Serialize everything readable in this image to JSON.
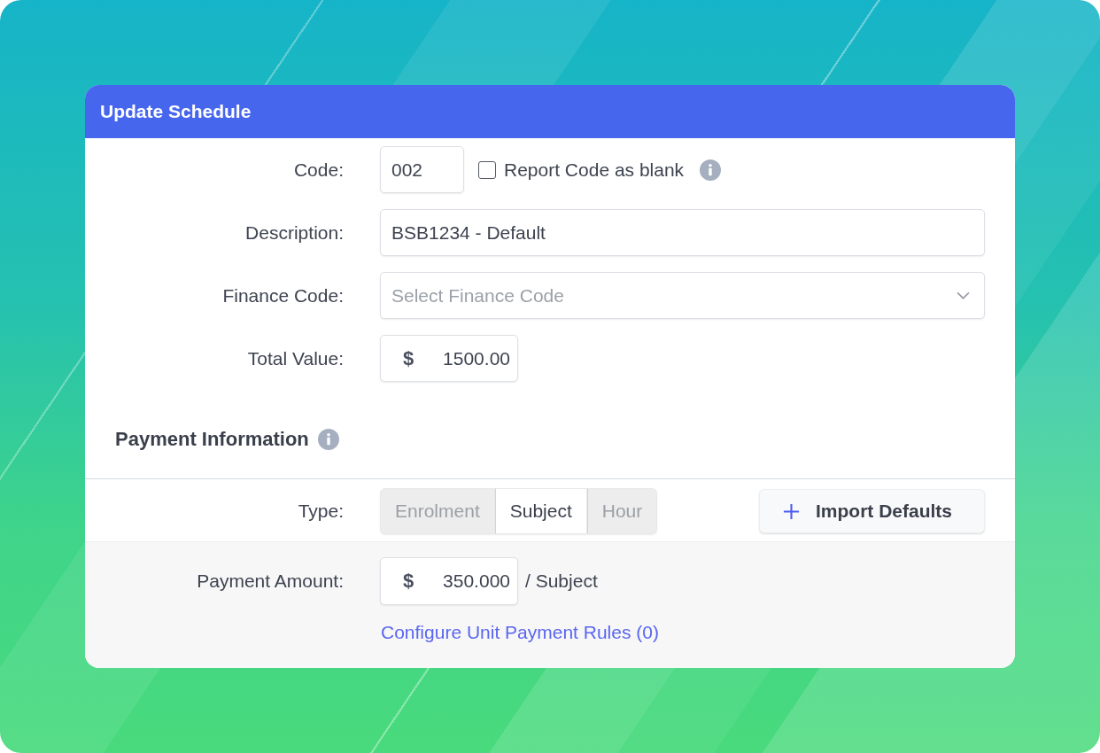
{
  "dialog": {
    "title": "Update Schedule"
  },
  "fields": [
    {
      "kind": "code",
      "label": "Code:",
      "value": "002",
      "checkbox": {
        "label": "Report Code as blank",
        "checked": false
      }
    },
    {
      "kind": "text",
      "label": "Description:",
      "value": "BSB1234 - Default"
    },
    {
      "kind": "select",
      "label": "Finance Code:",
      "placeholder": "Select Finance Code"
    },
    {
      "kind": "currency",
      "label": "Total Value:",
      "prefix": "$",
      "value": "1500.00"
    }
  ],
  "payment_information": {
    "heading": "Payment Information",
    "type": {
      "label": "Type:",
      "options": [
        {
          "label": "Enrolment",
          "selected": false
        },
        {
          "label": "Subject",
          "selected": true
        },
        {
          "label": "Hour",
          "selected": false
        }
      ]
    },
    "import_button": {
      "label": "Import Defaults"
    },
    "payment_amount": {
      "label": "Payment Amount:",
      "prefix": "$",
      "value": "350.000",
      "unit": "/ Subject"
    },
    "rules_link": "Configure Unit Payment Rules (0)"
  }
}
